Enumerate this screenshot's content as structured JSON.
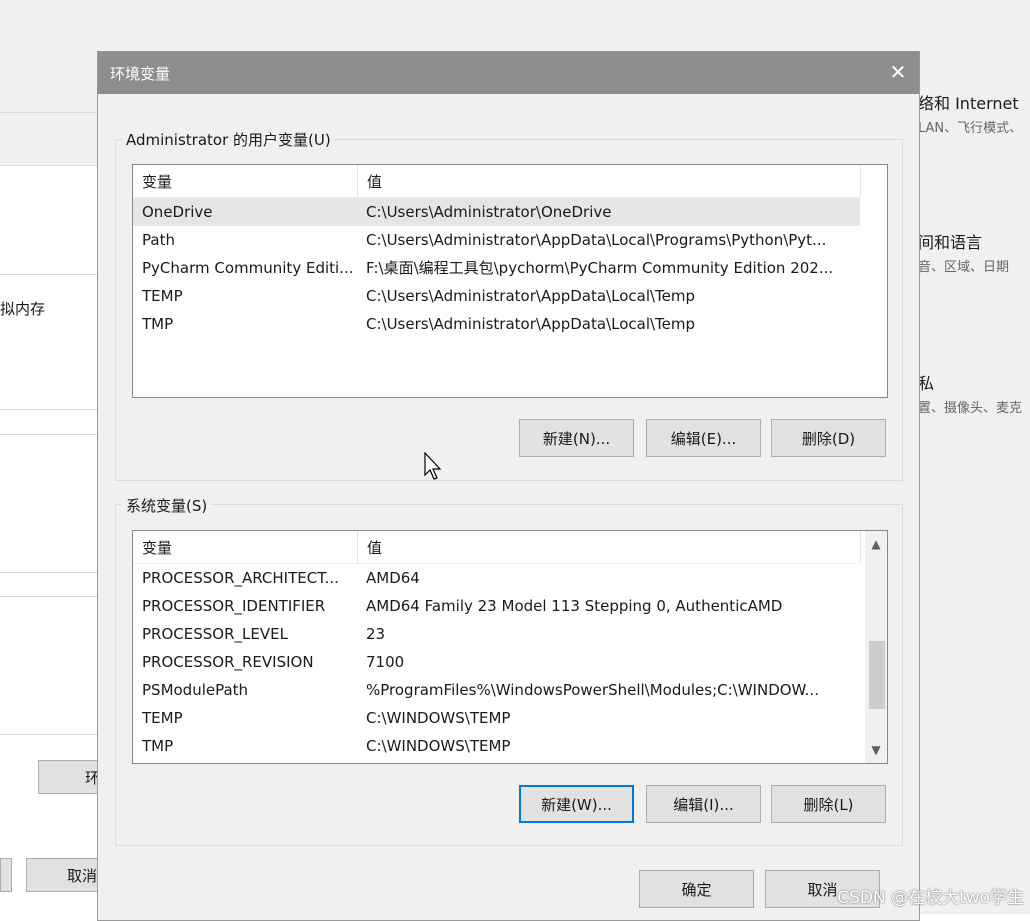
{
  "background": {
    "left_label": "拟内存",
    "left_button_1": "环",
    "left_button_2": "取消",
    "right_items": [
      {
        "title": "络和 Internet",
        "subtitle": "LAN、飞行模式、"
      },
      {
        "title": "间和语言",
        "subtitle": "音、区域、日期"
      },
      {
        "title": "私",
        "subtitle": "置、摄像头、麦克"
      }
    ]
  },
  "dialog": {
    "title": "环境变量",
    "close_glyph": "✕",
    "user_vars": {
      "group_label": "Administrator 的用户变量(U)",
      "header": {
        "name": "变量",
        "value": "值"
      },
      "rows": [
        {
          "name": "OneDrive",
          "value": "C:\\Users\\Administrator\\OneDrive"
        },
        {
          "name": "Path",
          "value": "C:\\Users\\Administrator\\AppData\\Local\\Programs\\Python\\Pyt..."
        },
        {
          "name": "PyCharm Community Editi...",
          "value": "F:\\桌面\\编程工具包\\pychorm\\PyCharm Community Edition 202..."
        },
        {
          "name": "TEMP",
          "value": "C:\\Users\\Administrator\\AppData\\Local\\Temp"
        },
        {
          "name": "TMP",
          "value": "C:\\Users\\Administrator\\AppData\\Local\\Temp"
        }
      ],
      "buttons": {
        "new": "新建(N)...",
        "edit": "编辑(E)...",
        "delete": "删除(D)"
      }
    },
    "system_vars": {
      "group_label": "系统变量(S)",
      "header": {
        "name": "变量",
        "value": "值"
      },
      "rows": [
        {
          "name": "PROCESSOR_ARCHITECT...",
          "value": "AMD64"
        },
        {
          "name": "PROCESSOR_IDENTIFIER",
          "value": "AMD64 Family 23 Model 113 Stepping 0, AuthenticAMD"
        },
        {
          "name": "PROCESSOR_LEVEL",
          "value": "23"
        },
        {
          "name": "PROCESSOR_REVISION",
          "value": "7100"
        },
        {
          "name": "PSModulePath",
          "value": "%ProgramFiles%\\WindowsPowerShell\\Modules;C:\\WINDOW..."
        },
        {
          "name": "TEMP",
          "value": "C:\\WINDOWS\\TEMP"
        },
        {
          "name": "TMP",
          "value": "C:\\WINDOWS\\TEMP"
        }
      ],
      "buttons": {
        "new": "新建(W)...",
        "edit": "编辑(I)...",
        "delete": "删除(L)"
      },
      "scroll_up": "▲",
      "scroll_down": "▼"
    },
    "ok": "确定",
    "cancel": "取消"
  },
  "watermark": "CSDN @在校大two学生"
}
